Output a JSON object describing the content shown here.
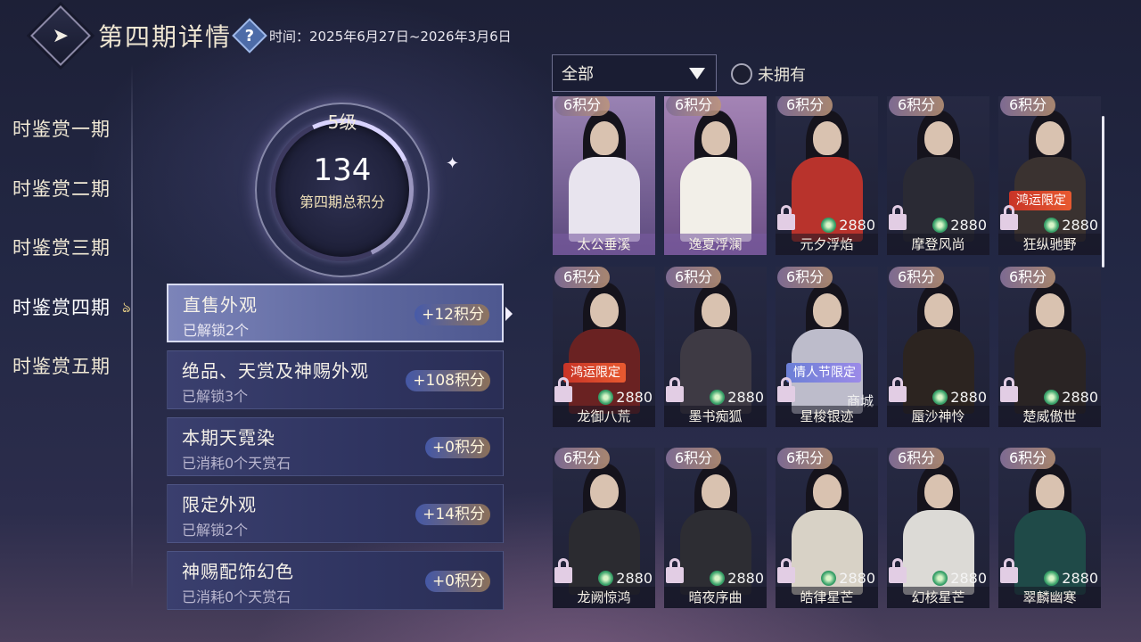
{
  "header": {
    "back_icon": "back-arrow-icon",
    "title": "第四期详情",
    "help_icon": "question-icon",
    "period": "时间：2025年6月27日~2026年3月6日"
  },
  "nav": {
    "items": [
      {
        "label": "时鉴赏一期"
      },
      {
        "label": "时鉴赏二期"
      },
      {
        "label": "时鉴赏三期"
      },
      {
        "label": "时鉴赏四期",
        "mark": "ঌ"
      },
      {
        "label": "时鉴赏五期"
      }
    ],
    "active_index": 3
  },
  "level": {
    "label": "5级",
    "score": "134",
    "caption": "第四期总积分"
  },
  "rows": [
    {
      "title": "直售外观",
      "sub": "已解锁2个",
      "badge": "+12积分"
    },
    {
      "title": "绝品、天赏及神赐外观",
      "sub": "已解锁3个",
      "badge": "+108积分"
    },
    {
      "title": "本期天霓染",
      "sub": "已消耗0个天赏石",
      "badge": "+0积分"
    },
    {
      "title": "限定外观",
      "sub": "已解锁2个",
      "badge": "+14积分"
    },
    {
      "title": "神赐配饰幻色",
      "sub": "已消耗0个天赏石",
      "badge": "+0积分"
    }
  ],
  "filter": {
    "selected": "全部",
    "toggle_label": "未拥有"
  },
  "cards": [
    {
      "score": "6积分",
      "name": "太公垂溪",
      "price": "",
      "tag": "",
      "source": "",
      "theme": "purple",
      "body": "#e8e4ee"
    },
    {
      "score": "6积分",
      "name": "逸夏浮澜",
      "price": "",
      "tag": "",
      "source": "",
      "theme": "purple2",
      "body": "#f2efe8"
    },
    {
      "score": "6积分",
      "name": "元夕浮焰",
      "price": "2880",
      "tag": "",
      "source": "",
      "theme": "",
      "body": "#b8332c"
    },
    {
      "score": "6积分",
      "name": "摩登风尚",
      "price": "2880",
      "tag": "",
      "source": "",
      "theme": "",
      "body": "#2a2a34"
    },
    {
      "score": "6积分",
      "name": "狂纵驰野",
      "price": "2880",
      "tag": "鸿运限定",
      "source": "",
      "theme": "",
      "body": "#3a3230"
    },
    {
      "score": "6积分",
      "name": "龙御八荒",
      "price": "2880",
      "tag": "鸿运限定",
      "source": "",
      "theme": "",
      "body": "#6a2222"
    },
    {
      "score": "6积分",
      "name": "墨书痴狐",
      "price": "2880",
      "tag": "",
      "source": "",
      "theme": "",
      "body": "#3e3a44"
    },
    {
      "score": "6积分",
      "name": "星梭银迹",
      "price": "",
      "tag": "情人节限定",
      "source": "商城",
      "theme": "",
      "body": "#bdbccb"
    },
    {
      "score": "6积分",
      "name": "蜃沙神怜",
      "price": "2880",
      "tag": "",
      "source": "",
      "theme": "",
      "body": "#2c2420"
    },
    {
      "score": "6积分",
      "name": "楚威傲世",
      "price": "2880",
      "tag": "",
      "source": "",
      "theme": "",
      "body": "#2a2424"
    },
    {
      "score": "6积分",
      "name": "龙阙惊鸿",
      "price": "2880",
      "tag": "",
      "source": "",
      "theme": "",
      "body": "#2b2b30"
    },
    {
      "score": "6积分",
      "name": "暗夜序曲",
      "price": "2880",
      "tag": "",
      "source": "",
      "theme": "",
      "body": "#2d2d33"
    },
    {
      "score": "6积分",
      "name": "皓律星芒",
      "price": "2880",
      "tag": "",
      "source": "",
      "theme": "",
      "body": "#d8d2c6"
    },
    {
      "score": "6积分",
      "name": "幻核星芒",
      "price": "2880",
      "tag": "",
      "source": "",
      "theme": "",
      "body": "#dcdad6"
    },
    {
      "score": "6积分",
      "name": "翠麟幽寒",
      "price": "2880",
      "tag": "",
      "source": "",
      "theme": "",
      "body": "#1f4a48"
    }
  ],
  "colors": {
    "accent_gold": "#efe0b8",
    "coin_green": "#3aa36a",
    "tag_red": "#c83427",
    "tag_blue": "#6b7fd6"
  }
}
